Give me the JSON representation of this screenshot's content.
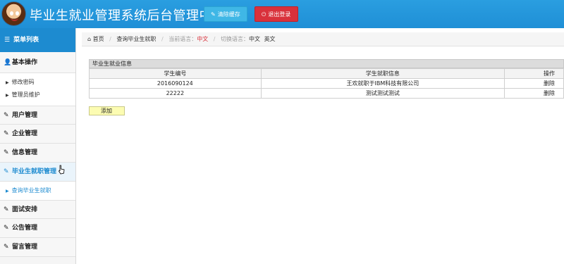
{
  "header": {
    "app_title": "毕业生就业管理系统后台管理中心",
    "clear_cache_label": "清除缓存",
    "logout_label": "退出登录"
  },
  "sidebar": {
    "title": "菜单列表",
    "groups": [
      {
        "label": "基本操作",
        "icon": "user-icon",
        "children": [
          "修改密码",
          "管理员维护"
        ]
      },
      {
        "label": "用户管理",
        "icon": "edit-icon"
      },
      {
        "label": "企业管理",
        "icon": "edit-icon"
      },
      {
        "label": "信息管理",
        "icon": "edit-icon"
      },
      {
        "label": "毕业生就职管理",
        "icon": "edit-icon",
        "active": true,
        "children": [
          "查询毕业生就职"
        ]
      },
      {
        "label": "面试安排",
        "icon": "edit-icon"
      },
      {
        "label": "公告管理",
        "icon": "edit-icon"
      },
      {
        "label": "留言管理",
        "icon": "edit-icon"
      }
    ]
  },
  "breadcrumb": {
    "home": "首页",
    "current": "查询毕业生就职",
    "lang_label": "当前语言：",
    "lang_value": "中文",
    "switch_label": "切换语言：",
    "switch_zh": "中文",
    "switch_en": "英文"
  },
  "table": {
    "title": "毕业生就业信息",
    "columns": [
      "学生编号",
      "学生就职信息",
      "操作"
    ],
    "rows": [
      {
        "id": "2016090124",
        "info": "王欢就职于IBM科技有限公司",
        "action": "删除"
      },
      {
        "id": "22222",
        "info": "测试测试测试",
        "action": "删除"
      }
    ]
  },
  "add_button_label": "添加",
  "colors": {
    "header_bg": "#1f8fd6",
    "clear_btn": "#3fb7e6",
    "logout_btn": "#d9313b",
    "active_menu": "#1d8bd0",
    "add_btn": "#fcfcb2"
  }
}
